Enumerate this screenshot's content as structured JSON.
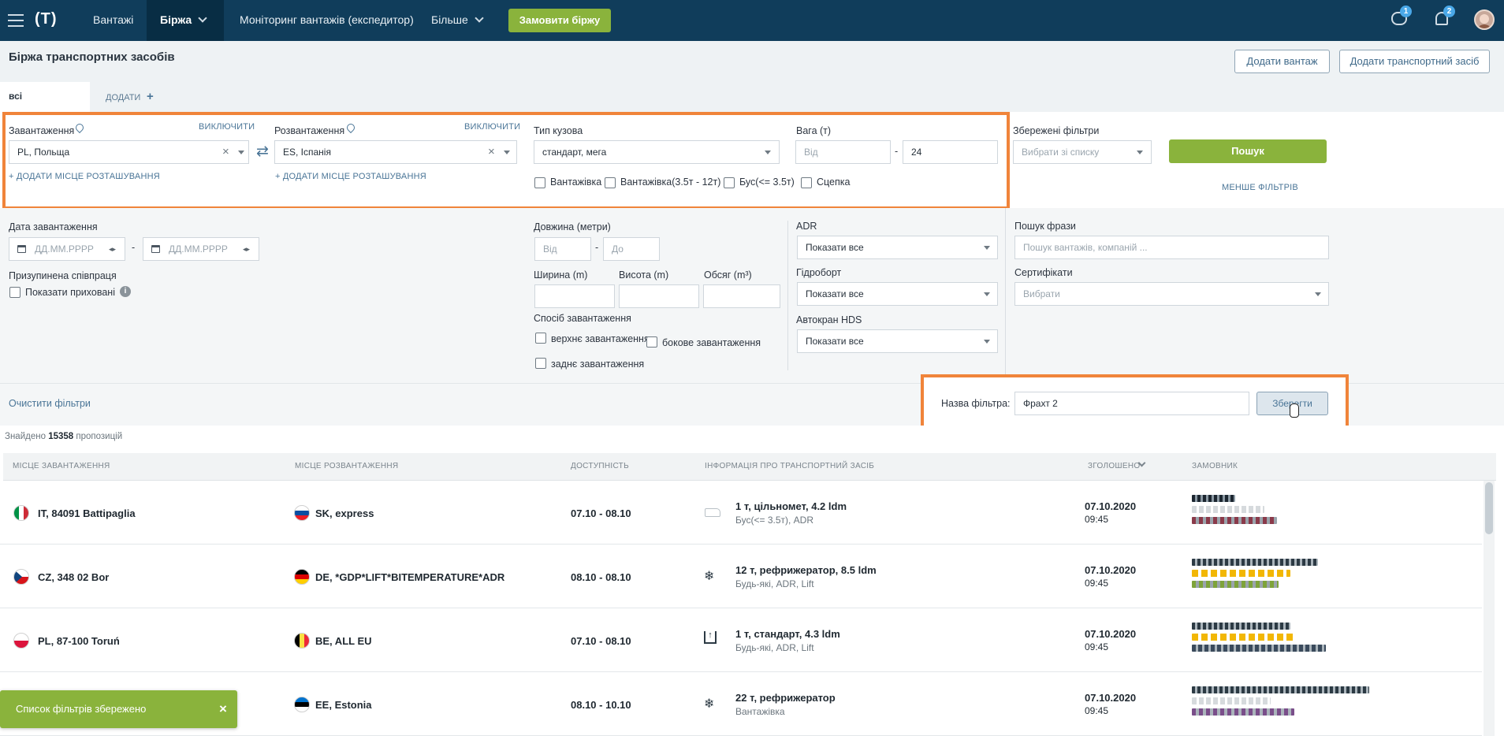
{
  "nav": {
    "logo": "(T)",
    "items": [
      "Вантажі",
      "Біржа",
      "Моніторинг вантажів (експедитор)",
      "Більше"
    ],
    "order_button": "Замовити біржу",
    "chat_badge": "1",
    "notif_badge": "2"
  },
  "page": {
    "title": "Біржа транспортних засобів",
    "add_cargo": "Додати вантаж",
    "add_vehicle": "Додати транспортний засіб",
    "tabs": {
      "all": "всі",
      "add": "ДОДАТИ"
    }
  },
  "filters": {
    "loading": {
      "label": "Завантаження",
      "exclude": "ВИКЛЮЧИТИ",
      "value": "PL,  Польща",
      "add_location": "+ ДОДАТИ МІСЦЕ РОЗТАШУВАННЯ"
    },
    "unloading": {
      "label": "Розвантаження",
      "exclude": "ВИКЛЮЧИТИ",
      "value": "ES,  Іспанія",
      "add_location": "+ ДОДАТИ МІСЦЕ РОЗТАШУВАННЯ"
    },
    "body_type": {
      "label": "Тип кузова",
      "value": "стандарт, мега",
      "options": [
        "Вантажівка",
        "Вантажівка(3.5т - 12т)",
        "Бус(<= 3.5т)",
        "Сцепка"
      ]
    },
    "weight": {
      "label": "Вага (т)",
      "from_placeholder": "Від",
      "to_value": "24"
    },
    "saved_filters": {
      "label": "Збережені фільтри",
      "placeholder": "Вибрати зі списку"
    },
    "search_button": "Пошук",
    "less_filters": "МЕНШЕ ФІЛЬТРІВ",
    "loading_date": {
      "label": "Дата завантаження",
      "placeholder": "ДД.ММ.РРРР"
    },
    "suspended": {
      "label": "Призупинена співпраця",
      "show_hidden": "Показати приховані"
    },
    "length": {
      "label": "Довжина (метри)",
      "from": "Від",
      "to": "До"
    },
    "width": "Ширина (m)",
    "height": "Висота (m)",
    "volume": "Обсяг (m³)",
    "loading_method": {
      "label": "Спосіб завантаження",
      "top": "верхнє завантаження",
      "side": "бокове завантаження",
      "rear": "заднє завантаження"
    },
    "adr": {
      "label": "ADR",
      "value": "Показати все"
    },
    "tail_lift": {
      "label": "Гідроборт",
      "value": "Показати все"
    },
    "crane": {
      "label": "Автокран HDS",
      "value": "Показати все"
    },
    "phrase": {
      "label": "Пошук фрази",
      "placeholder": "Пошук вантажів, компаній ..."
    },
    "certificates": {
      "label": "Сертифікати",
      "placeholder": "Вибрати"
    },
    "clear": "Очистити фільтри",
    "filter_name_label": "Назва фільтра:",
    "filter_name_value": "Фрахт 2",
    "save_button": "Зберегти"
  },
  "results": {
    "found_prefix": "Знайдено",
    "found_count": "15358",
    "found_suffix": "пропозицій",
    "columns": [
      "МІСЦЕ ЗАВАНТАЖЕННЯ",
      "МІСЦЕ РОЗВАНТАЖЕННЯ",
      "ДОСТУПНІСТЬ",
      "ІНФОРМАЦІЯ ПРО ТРАНСПОРТНИЙ ЗАСІБ",
      "ЗГОЛОШЕНО",
      "ЗАМОВНИК"
    ],
    "rows": [
      {
        "from": "IT, 84091 Battipaglia",
        "to": "SK, express",
        "avail": "07.10 - 08.10",
        "info": "1 т, цільномет, 4.2 ldm",
        "info_sub": "Бус(<= 3.5т), ADR",
        "date": "07.10.2020",
        "time": "09:45"
      },
      {
        "from": "CZ, 348 02 Bor",
        "to": "DE, *GDP*LIFT*BITEMPERATURE*ADR",
        "avail": "08.10 - 08.10",
        "info": "12 т, рефрижератор, 8.5 ldm",
        "info_sub": "Будь-які, ADR, Lift",
        "date": "07.10.2020",
        "time": "09:45"
      },
      {
        "from": "PL, 87-100 Toruń",
        "to": "BE, ALL EU",
        "avail": "07.10 - 08.10",
        "info": "1 т, стандарт, 4.3 ldm",
        "info_sub": "Будь-які, ADR, Lift",
        "date": "07.10.2020",
        "time": "09:45"
      },
      {
        "from": "",
        "to": "EE, Estonia",
        "avail": "08.10 - 10.10",
        "info": "22 т, рефрижератор",
        "info_sub": "Вантажівка",
        "date": "07.10.2020",
        "time": "09:45"
      }
    ]
  },
  "toast": {
    "text": "Список фільтрів збережено",
    "close": "×"
  }
}
